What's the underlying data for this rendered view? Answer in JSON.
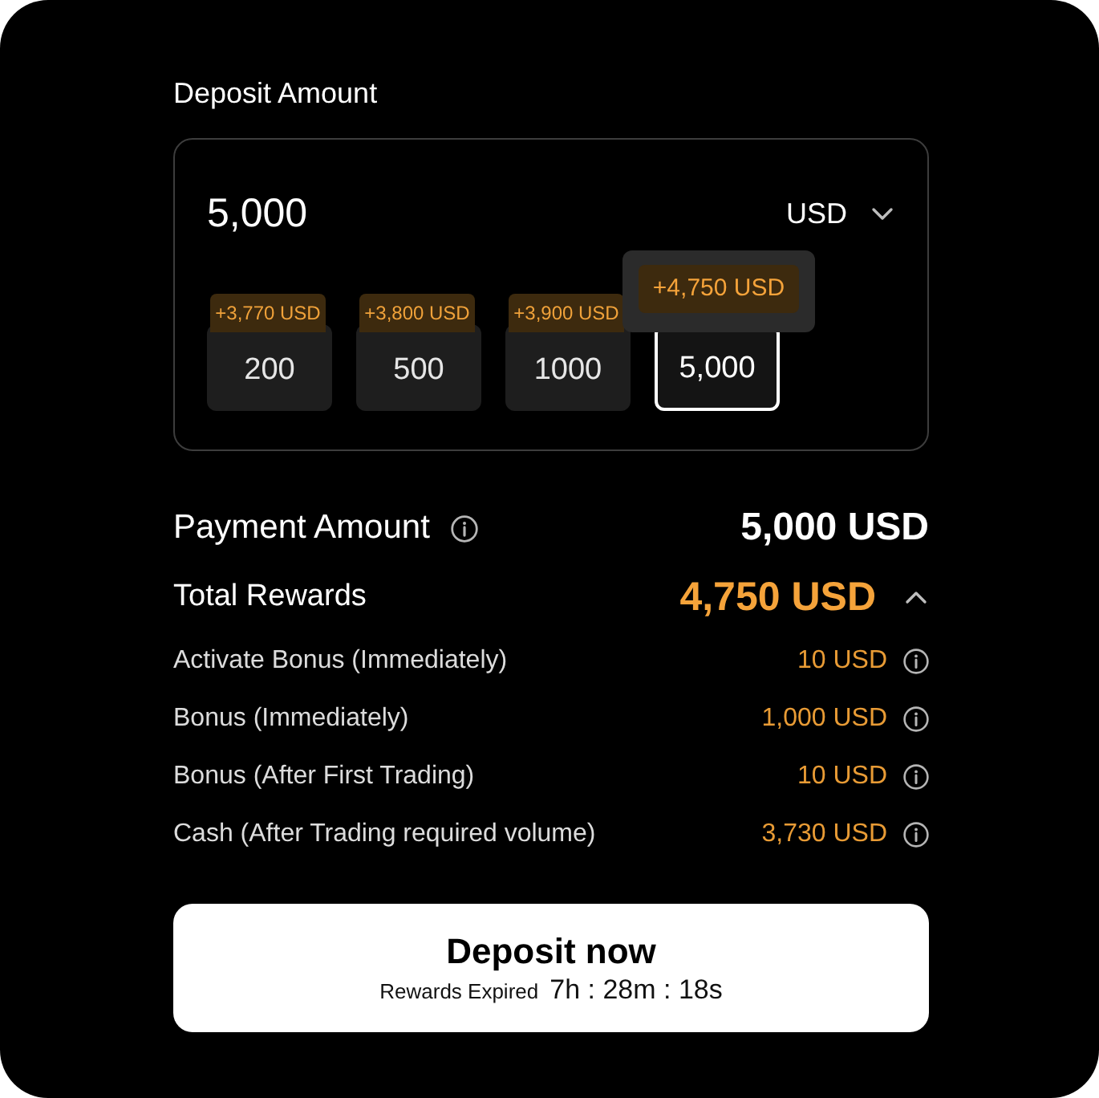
{
  "deposit": {
    "label": "Deposit Amount",
    "amount": "5,000",
    "currency": "USD",
    "presets": [
      {
        "amount": "200",
        "bonus": "+3,770 USD",
        "selected": false
      },
      {
        "amount": "500",
        "bonus": "+3,800 USD",
        "selected": false
      },
      {
        "amount": "1000",
        "bonus": "+3,900 USD",
        "selected": false
      },
      {
        "amount": "5,000",
        "bonus": "+4,750 USD",
        "selected": true
      }
    ]
  },
  "payment": {
    "label": "Payment Amount",
    "value": "5,000 USD"
  },
  "rewards": {
    "label": "Total Rewards",
    "value": "4,750 USD",
    "expanded": true,
    "items": [
      {
        "label": "Activate Bonus (Immediately)",
        "value": "10 USD"
      },
      {
        "label": "Bonus (Immediately)",
        "value": "1,000 USD"
      },
      {
        "label": "Bonus (After First Trading)",
        "value": "10 USD"
      },
      {
        "label": "Cash (After Trading required volume)",
        "value": "3,730 USD"
      }
    ]
  },
  "deposit_button": {
    "label": "Deposit now",
    "expiry_label": "Rewards Expired",
    "countdown": "7h : 28m : 18s"
  }
}
